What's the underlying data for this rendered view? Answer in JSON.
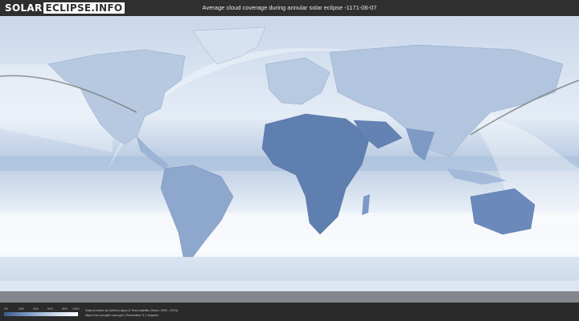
{
  "header": {
    "logo_part1": "SOLAR",
    "logo_part2": "ECLIPSE.INFO",
    "title": "Average cloud coverage during annular solar eclipse -1171-06-07"
  },
  "map": {
    "type": "world cloud coverage map",
    "colors": {
      "clear": "#3e5a8a",
      "cloudy": "#ffffff",
      "ocean_light": "#dfe8f3",
      "frame": "#2b2b2b"
    }
  },
  "legend": {
    "ticks": [
      "0%",
      "20%",
      "40%",
      "60%",
      "80%",
      "100%"
    ],
    "colors": [
      "#3e5a8a",
      "#7f9cc6",
      "#c7d6ea",
      "#ffffff"
    ]
  },
  "footer": {
    "line1": "Data provided by NASA's Aqua & Terra satellite (Years: 2000 - 2019)",
    "line2": "https://neo.sci.gsfc.nasa.gov | Resolution: 0.1 degrees"
  }
}
